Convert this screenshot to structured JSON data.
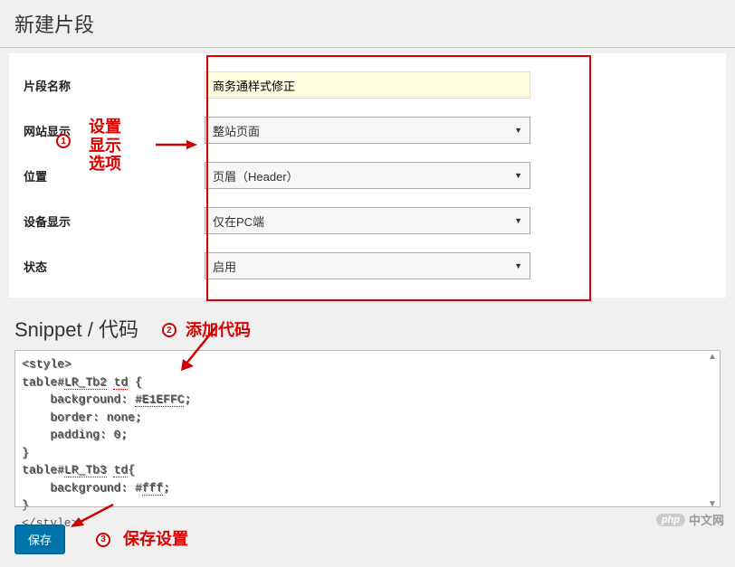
{
  "page": {
    "title": "新建片段",
    "section_code": "Snippet / 代码"
  },
  "form": {
    "name": {
      "label": "片段名称",
      "value": "商务通样式修正"
    },
    "display": {
      "label": "网站显示",
      "value": "整站页面"
    },
    "position": {
      "label": "位置",
      "value": "页眉（Header）"
    },
    "device": {
      "label": "设备显示",
      "value": "仅在PC端"
    },
    "status": {
      "label": "状态",
      "value": "启用"
    }
  },
  "annotations": {
    "badge1": "1",
    "badge2": "2",
    "badge3": "3",
    "text1_line1": "设置",
    "text1_line2": "显示",
    "text1_line3": "选项",
    "text2": "添加代码",
    "text3": "保存设置"
  },
  "code": {
    "content": "<style>\ntable#LR_Tb2 td {\n    background: #E1EFFC;\n    border: none;\n    padding: 0;\n}\ntable#LR_Tb3 td{\n    background: #fff;\n}\n</style>"
  },
  "actions": {
    "save": "保存"
  },
  "watermark": {
    "logo": "php",
    "text": "中文网"
  }
}
